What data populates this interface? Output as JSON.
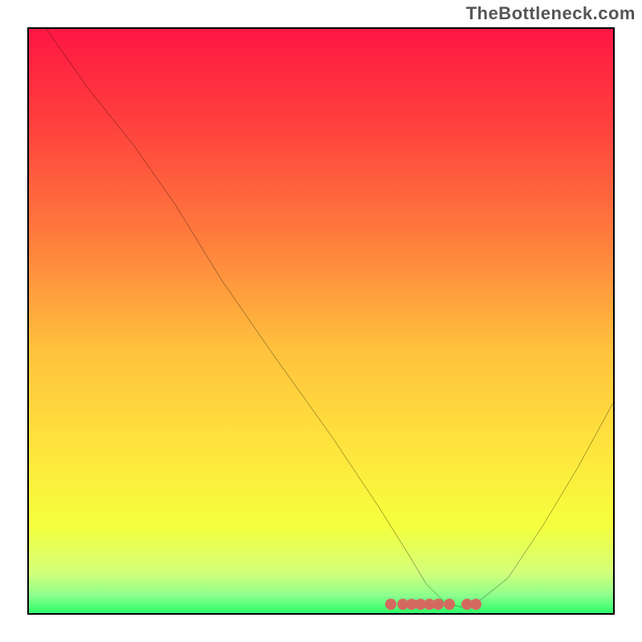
{
  "watermark": "TheBottleneck.com",
  "chart_data": {
    "type": "line",
    "title": "",
    "xlabel": "",
    "ylabel": "",
    "xlim": [
      0,
      100
    ],
    "ylim": [
      0,
      100
    ],
    "grid": false,
    "legend": false,
    "background_gradient": {
      "stops": [
        {
          "pos": 0.0,
          "color": "#ff1744"
        },
        {
          "pos": 0.15,
          "color": "#ff3d3d"
        },
        {
          "pos": 0.35,
          "color": "#ff7a3d"
        },
        {
          "pos": 0.55,
          "color": "#ffc23d"
        },
        {
          "pos": 0.72,
          "color": "#ffe53d"
        },
        {
          "pos": 0.85,
          "color": "#f5ff3d"
        },
        {
          "pos": 0.93,
          "color": "#d4ff7a"
        },
        {
          "pos": 0.97,
          "color": "#8cff8c"
        },
        {
          "pos": 1.0,
          "color": "#2cff6a"
        }
      ]
    },
    "series": [
      {
        "name": "bottleneck-curve",
        "color": "#000000",
        "x": [
          3,
          10,
          18,
          25,
          33,
          42,
          52,
          60,
          65,
          68,
          71,
          74,
          77,
          82,
          88,
          94,
          100
        ],
        "y": [
          100,
          90,
          80,
          70,
          57,
          44,
          30,
          18,
          10,
          5,
          2,
          1,
          2,
          6,
          15,
          25,
          36
        ]
      }
    ],
    "markers": {
      "name": "optimal-range-dots",
      "color": "#d46a5f",
      "x": [
        62,
        64,
        65.5,
        67,
        68.5,
        70,
        72,
        75,
        76.5
      ],
      "y": [
        1,
        1,
        1,
        1,
        1,
        1,
        1,
        1,
        1
      ]
    }
  }
}
